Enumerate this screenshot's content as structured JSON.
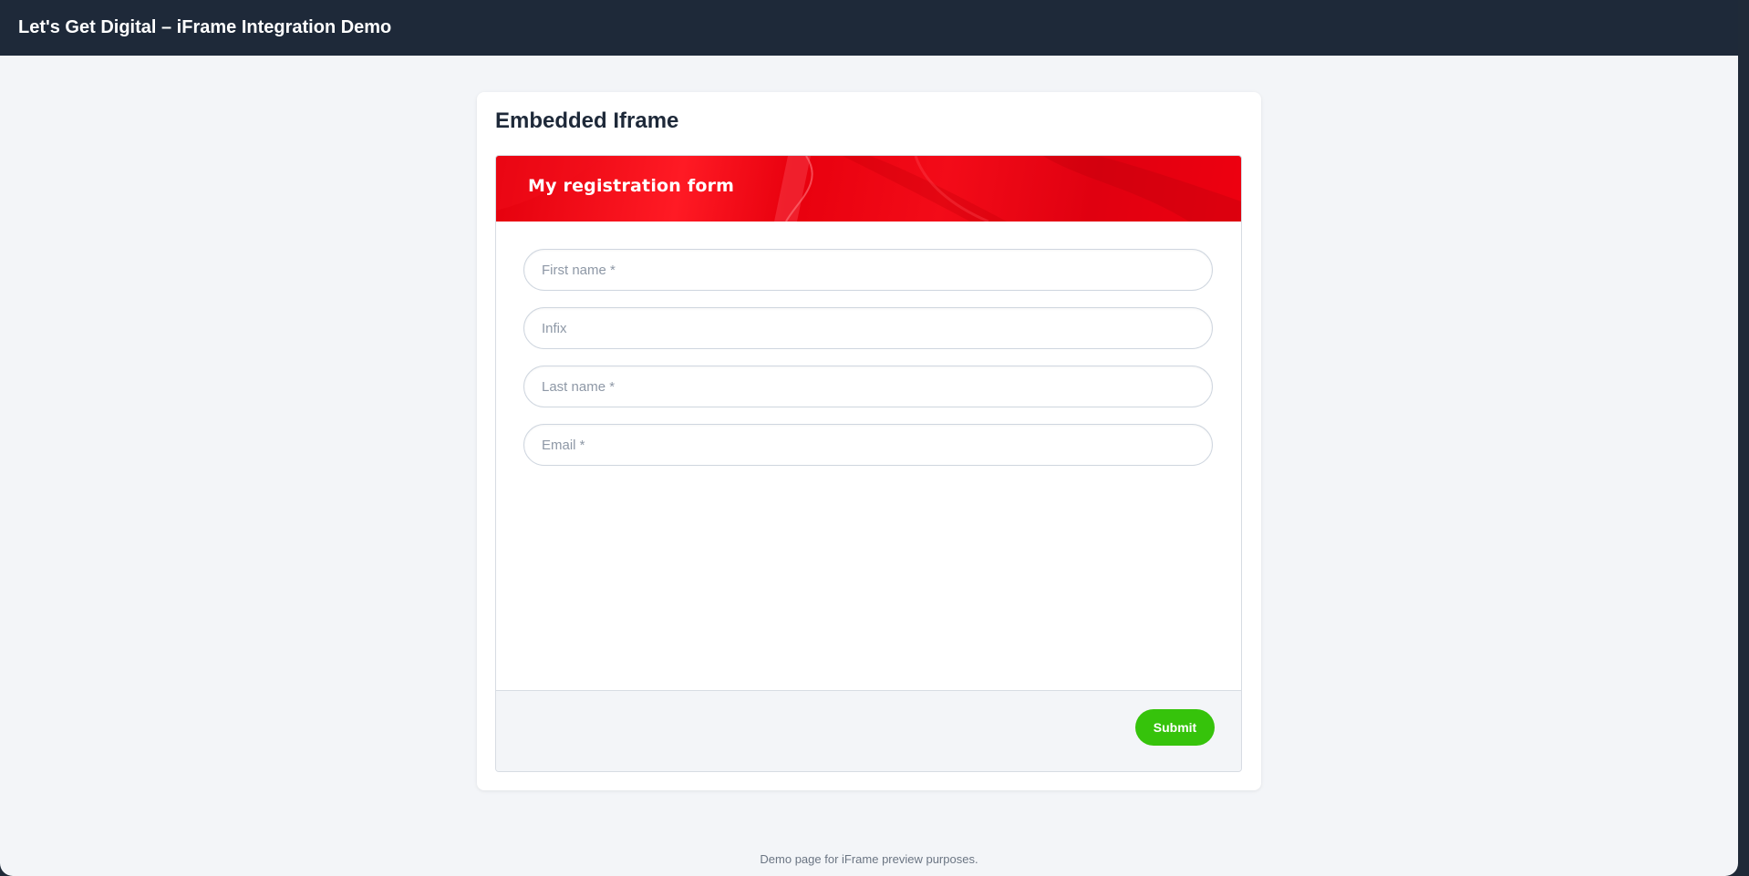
{
  "app": {
    "title": "Let's Get Digital – iFrame Integration Demo"
  },
  "card": {
    "title": "Embedded Iframe"
  },
  "form": {
    "header_title": "My registration form",
    "header_color": "#e4000d",
    "fields": [
      {
        "placeholder": "First name *",
        "value": ""
      },
      {
        "placeholder": "Infix",
        "value": ""
      },
      {
        "placeholder": "Last name *",
        "value": ""
      },
      {
        "placeholder": "Email *",
        "value": ""
      }
    ],
    "submit_label": "Submit",
    "submit_color": "#36c30b"
  },
  "footer": {
    "note": "Demo page for iFrame preview purposes."
  }
}
